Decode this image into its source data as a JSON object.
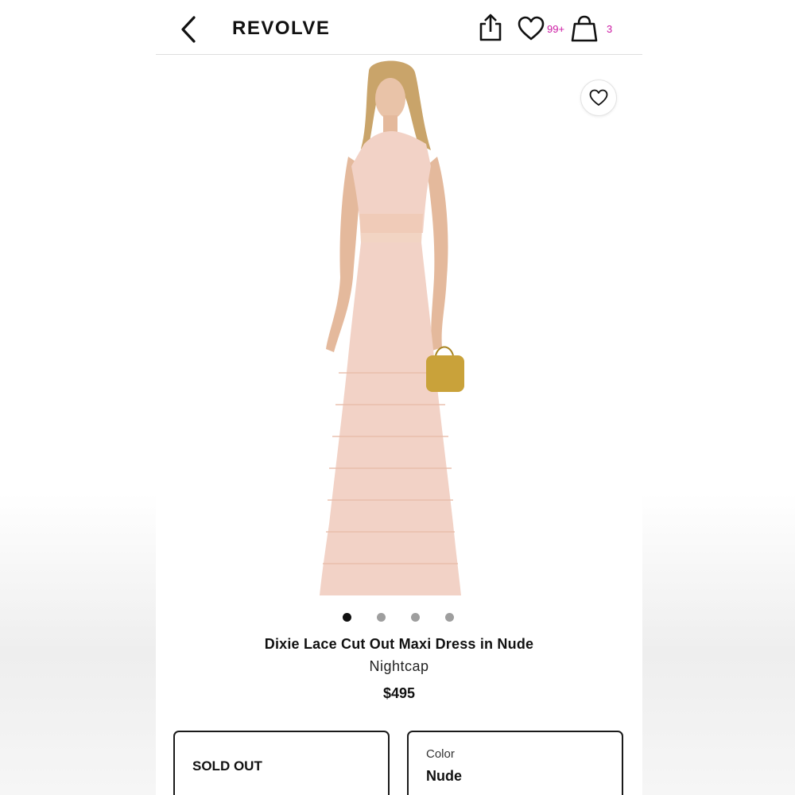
{
  "header": {
    "logo": "REVOLVE",
    "wishlist_count": "99+",
    "bag_count": "3"
  },
  "product": {
    "title": "Dixie Lace Cut Out Maxi Dress in Nude",
    "brand": "Nightcap",
    "price": "$495",
    "image_count": 4,
    "active_image_index": 0
  },
  "size_selector": {
    "label": "SOLD OUT"
  },
  "color_selector": {
    "label": "Color",
    "value": "Nude"
  },
  "colors": {
    "badge": "#cc1aa3",
    "dress": "#f2d2c6",
    "clutch": "#c9a23a"
  }
}
